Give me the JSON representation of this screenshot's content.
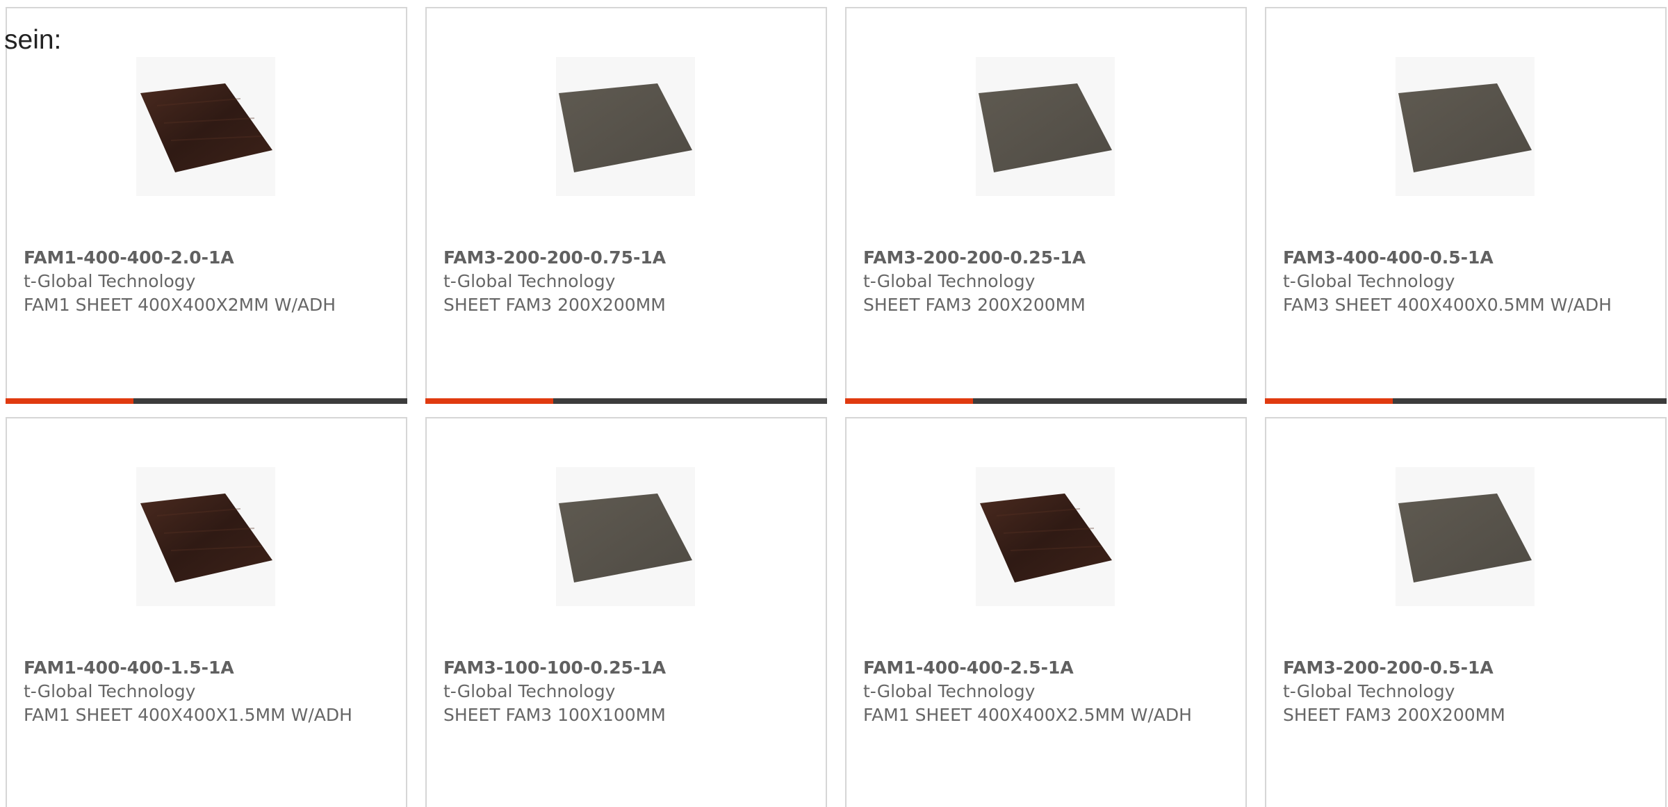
{
  "intro_text": "sein:",
  "colors": {
    "accent": "#e03a10",
    "bar_dark": "#3c3c3c",
    "card_border": "#d6d6d6",
    "text_gray": "#666666",
    "sheet_fam1": "#3a1f16",
    "sheet_fam3": "#5b564e"
  },
  "products": [
    {
      "part_number": "FAM1-400-400-2.0-1A",
      "manufacturer": "t-Global Technology",
      "description": "FAM1 SHEET 400X400X2MM W/ADH",
      "image": "fam1-sheet-image"
    },
    {
      "part_number": "FAM3-200-200-0.75-1A",
      "manufacturer": "t-Global Technology",
      "description": "SHEET FAM3 200X200MM",
      "image": "fam3-sheet-image"
    },
    {
      "part_number": "FAM3-200-200-0.25-1A",
      "manufacturer": "t-Global Technology",
      "description": "SHEET FAM3 200X200MM",
      "image": "fam3-sheet-image"
    },
    {
      "part_number": "FAM3-400-400-0.5-1A",
      "manufacturer": "t-Global Technology",
      "description": "FAM3 SHEET 400X400X0.5MM W/ADH",
      "image": "fam3-sheet-image"
    },
    {
      "part_number": "FAM1-400-400-1.5-1A",
      "manufacturer": "t-Global Technology",
      "description": "FAM1 SHEET 400X400X1.5MM W/ADH",
      "image": "fam1-sheet-image"
    },
    {
      "part_number": "FAM3-100-100-0.25-1A",
      "manufacturer": "t-Global Technology",
      "description": "SHEET FAM3 100X100MM",
      "image": "fam3-sheet-image"
    },
    {
      "part_number": "FAM1-400-400-2.5-1A",
      "manufacturer": "t-Global Technology",
      "description": "FAM1 SHEET 400X400X2.5MM W/ADH",
      "image": "fam1-sheet-image"
    },
    {
      "part_number": "FAM3-200-200-0.5-1A",
      "manufacturer": "t-Global Technology",
      "description": "SHEET FAM3 200X200MM",
      "image": "fam3-sheet-image"
    }
  ]
}
